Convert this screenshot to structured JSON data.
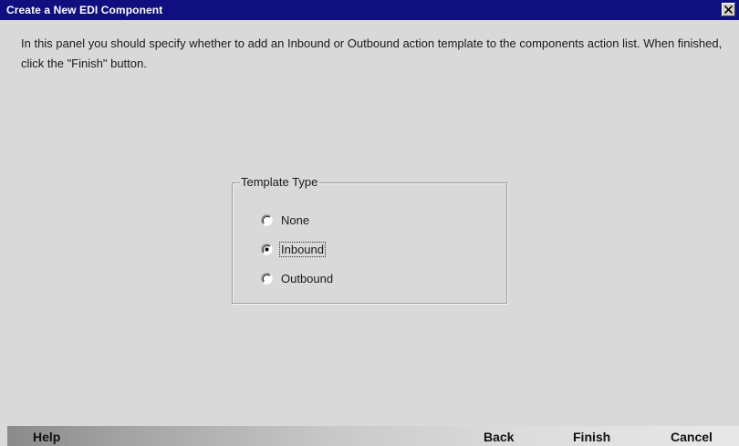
{
  "window": {
    "title": "Create a New EDI Component"
  },
  "instructions": "In this panel you should specify whether to add an Inbound or Outbound action template to the components action list.  When finished, click the \"Finish\" button.",
  "template_group": {
    "legend": "Template Type",
    "options": [
      {
        "label": "None",
        "selected": false
      },
      {
        "label": "Inbound",
        "selected": true
      },
      {
        "label": "Outbound",
        "selected": false
      }
    ]
  },
  "footer": {
    "help_label": "Help",
    "back_label": "Back",
    "finish_label": "Finish",
    "cancel_label": "Cancel"
  },
  "colors": {
    "titlebar": "#0f0f7f",
    "background": "#d9d9d9"
  }
}
